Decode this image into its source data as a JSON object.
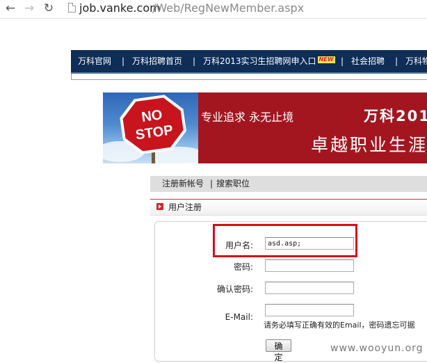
{
  "browser": {
    "back_icon": "back-arrow-icon",
    "forward_icon": "forward-arrow-icon",
    "reload_icon": "reload-icon",
    "url_host": "job.vanke.com",
    "url_path": "/Web/RegNewMember.aspx"
  },
  "navbar": {
    "items": [
      "万科官网",
      "万科招聘首页",
      "万科2013实习生招聘网申入口",
      "社会招聘",
      "万科物"
    ],
    "new_badge": "NEW",
    "separator": "|"
  },
  "banner": {
    "sign_line1": "NO",
    "sign_line2": "STOP",
    "slogan": "专业追求 永无止境",
    "brand": "万科201",
    "career": "卓越职业生涯"
  },
  "tabs": {
    "register": "注册新帐号",
    "separator": "|",
    "search_jobs": "搜索职位"
  },
  "section": {
    "title": "用户注册"
  },
  "form": {
    "username_label": "用户名:",
    "username_value": "asd.asp;",
    "password_label": "密码:",
    "confirm_label": "确认密码:",
    "email_label": "E-Mail:",
    "email_hint": "请务必填写正确有效的Email，密码遗忘可据",
    "submit_label": "确定"
  },
  "watermark": "www.wooyun.org",
  "colors": {
    "nav_bg": "#0e2d57",
    "banner_red": "#a31620",
    "highlight": "#d0101a"
  }
}
